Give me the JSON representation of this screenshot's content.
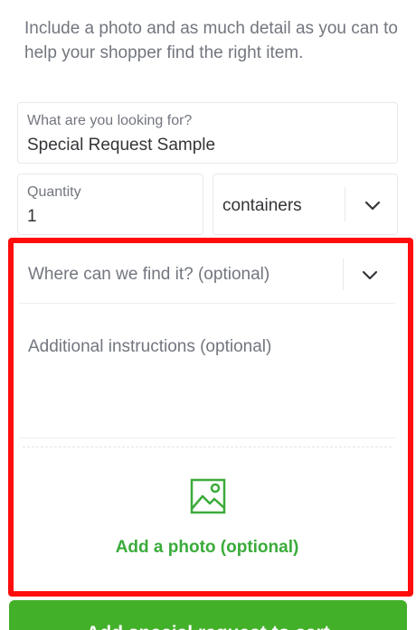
{
  "intro_text": "Include a photo and as much detail as you can to help your shopper find the right item.",
  "looking_for": {
    "label": "What are you looking for?",
    "value": "Special Request Sample"
  },
  "quantity": {
    "label": "Quantity",
    "value": "1"
  },
  "unit_select": {
    "value": "containers",
    "icon": "chevron-down-icon"
  },
  "where_select": {
    "placeholder": "Where can we find it? (optional)",
    "icon": "chevron-down-icon"
  },
  "instructions": {
    "placeholder": "Additional instructions (optional)"
  },
  "photo": {
    "label": "Add a photo (optional)",
    "icon": "image-icon"
  },
  "cta_label": "Add special request to cart",
  "colors": {
    "accent": "#43b02a",
    "photo_green": "#3aab3a",
    "highlight": "#ff0d0d"
  }
}
